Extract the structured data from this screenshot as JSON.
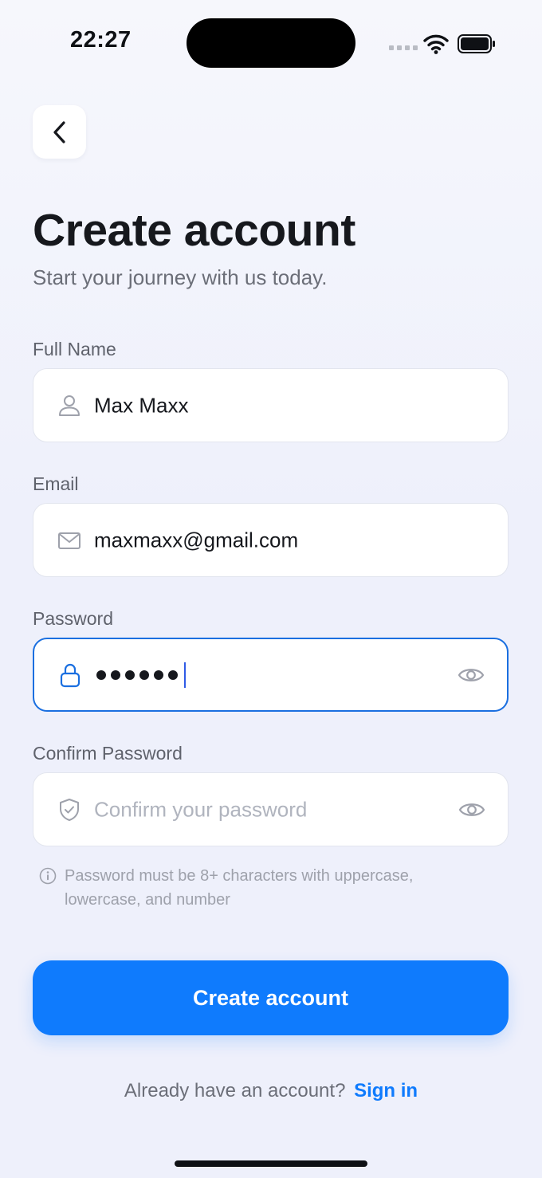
{
  "status_bar": {
    "time": "22:27"
  },
  "header": {
    "title": "Create account",
    "subtitle": "Start your journey with us today."
  },
  "form": {
    "full_name": {
      "label": "Full Name",
      "value": "Max Maxx",
      "icon": "person-icon"
    },
    "email": {
      "label": "Email",
      "value": "maxmaxx@gmail.com",
      "icon": "envelope-icon"
    },
    "password": {
      "label": "Password",
      "masked_length": 6,
      "icon": "lock-icon",
      "focused": true
    },
    "confirm_password": {
      "label": "Confirm Password",
      "placeholder": "Confirm your password",
      "icon": "shield-check-icon"
    },
    "hint": "Password must be 8+ characters with uppercase, lowercase, and number"
  },
  "actions": {
    "create_label": "Create account",
    "signin_prompt": "Already have an account?",
    "signin_link": "Sign in"
  },
  "colors": {
    "accent": "#0f7bfd",
    "focus_border": "#1a6fe0",
    "text_primary": "#16181d",
    "text_secondary": "#6b6e78",
    "background": "#eef0fb"
  }
}
